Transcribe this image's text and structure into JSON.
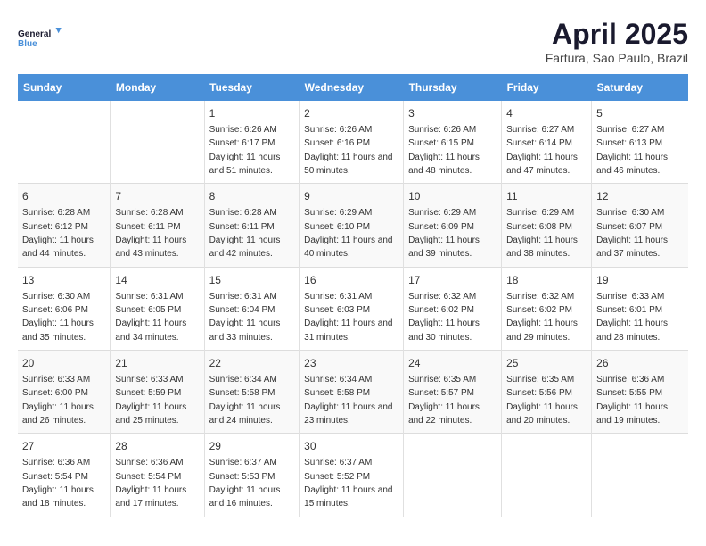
{
  "logo": {
    "line1": "General",
    "line2": "Blue"
  },
  "title": "April 2025",
  "subtitle": "Fartura, Sao Paulo, Brazil",
  "weekdays": [
    "Sunday",
    "Monday",
    "Tuesday",
    "Wednesday",
    "Thursday",
    "Friday",
    "Saturday"
  ],
  "weeks": [
    [
      {
        "day": "",
        "info": ""
      },
      {
        "day": "",
        "info": ""
      },
      {
        "day": "1",
        "info": "Sunrise: 6:26 AM\nSunset: 6:17 PM\nDaylight: 11 hours and 51 minutes."
      },
      {
        "day": "2",
        "info": "Sunrise: 6:26 AM\nSunset: 6:16 PM\nDaylight: 11 hours and 50 minutes."
      },
      {
        "day": "3",
        "info": "Sunrise: 6:26 AM\nSunset: 6:15 PM\nDaylight: 11 hours and 48 minutes."
      },
      {
        "day": "4",
        "info": "Sunrise: 6:27 AM\nSunset: 6:14 PM\nDaylight: 11 hours and 47 minutes."
      },
      {
        "day": "5",
        "info": "Sunrise: 6:27 AM\nSunset: 6:13 PM\nDaylight: 11 hours and 46 minutes."
      }
    ],
    [
      {
        "day": "6",
        "info": "Sunrise: 6:28 AM\nSunset: 6:12 PM\nDaylight: 11 hours and 44 minutes."
      },
      {
        "day": "7",
        "info": "Sunrise: 6:28 AM\nSunset: 6:11 PM\nDaylight: 11 hours and 43 minutes."
      },
      {
        "day": "8",
        "info": "Sunrise: 6:28 AM\nSunset: 6:11 PM\nDaylight: 11 hours and 42 minutes."
      },
      {
        "day": "9",
        "info": "Sunrise: 6:29 AM\nSunset: 6:10 PM\nDaylight: 11 hours and 40 minutes."
      },
      {
        "day": "10",
        "info": "Sunrise: 6:29 AM\nSunset: 6:09 PM\nDaylight: 11 hours and 39 minutes."
      },
      {
        "day": "11",
        "info": "Sunrise: 6:29 AM\nSunset: 6:08 PM\nDaylight: 11 hours and 38 minutes."
      },
      {
        "day": "12",
        "info": "Sunrise: 6:30 AM\nSunset: 6:07 PM\nDaylight: 11 hours and 37 minutes."
      }
    ],
    [
      {
        "day": "13",
        "info": "Sunrise: 6:30 AM\nSunset: 6:06 PM\nDaylight: 11 hours and 35 minutes."
      },
      {
        "day": "14",
        "info": "Sunrise: 6:31 AM\nSunset: 6:05 PM\nDaylight: 11 hours and 34 minutes."
      },
      {
        "day": "15",
        "info": "Sunrise: 6:31 AM\nSunset: 6:04 PM\nDaylight: 11 hours and 33 minutes."
      },
      {
        "day": "16",
        "info": "Sunrise: 6:31 AM\nSunset: 6:03 PM\nDaylight: 11 hours and 31 minutes."
      },
      {
        "day": "17",
        "info": "Sunrise: 6:32 AM\nSunset: 6:02 PM\nDaylight: 11 hours and 30 minutes."
      },
      {
        "day": "18",
        "info": "Sunrise: 6:32 AM\nSunset: 6:02 PM\nDaylight: 11 hours and 29 minutes."
      },
      {
        "day": "19",
        "info": "Sunrise: 6:33 AM\nSunset: 6:01 PM\nDaylight: 11 hours and 28 minutes."
      }
    ],
    [
      {
        "day": "20",
        "info": "Sunrise: 6:33 AM\nSunset: 6:00 PM\nDaylight: 11 hours and 26 minutes."
      },
      {
        "day": "21",
        "info": "Sunrise: 6:33 AM\nSunset: 5:59 PM\nDaylight: 11 hours and 25 minutes."
      },
      {
        "day": "22",
        "info": "Sunrise: 6:34 AM\nSunset: 5:58 PM\nDaylight: 11 hours and 24 minutes."
      },
      {
        "day": "23",
        "info": "Sunrise: 6:34 AM\nSunset: 5:58 PM\nDaylight: 11 hours and 23 minutes."
      },
      {
        "day": "24",
        "info": "Sunrise: 6:35 AM\nSunset: 5:57 PM\nDaylight: 11 hours and 22 minutes."
      },
      {
        "day": "25",
        "info": "Sunrise: 6:35 AM\nSunset: 5:56 PM\nDaylight: 11 hours and 20 minutes."
      },
      {
        "day": "26",
        "info": "Sunrise: 6:36 AM\nSunset: 5:55 PM\nDaylight: 11 hours and 19 minutes."
      }
    ],
    [
      {
        "day": "27",
        "info": "Sunrise: 6:36 AM\nSunset: 5:54 PM\nDaylight: 11 hours and 18 minutes."
      },
      {
        "day": "28",
        "info": "Sunrise: 6:36 AM\nSunset: 5:54 PM\nDaylight: 11 hours and 17 minutes."
      },
      {
        "day": "29",
        "info": "Sunrise: 6:37 AM\nSunset: 5:53 PM\nDaylight: 11 hours and 16 minutes."
      },
      {
        "day": "30",
        "info": "Sunrise: 6:37 AM\nSunset: 5:52 PM\nDaylight: 11 hours and 15 minutes."
      },
      {
        "day": "",
        "info": ""
      },
      {
        "day": "",
        "info": ""
      },
      {
        "day": "",
        "info": ""
      }
    ]
  ]
}
